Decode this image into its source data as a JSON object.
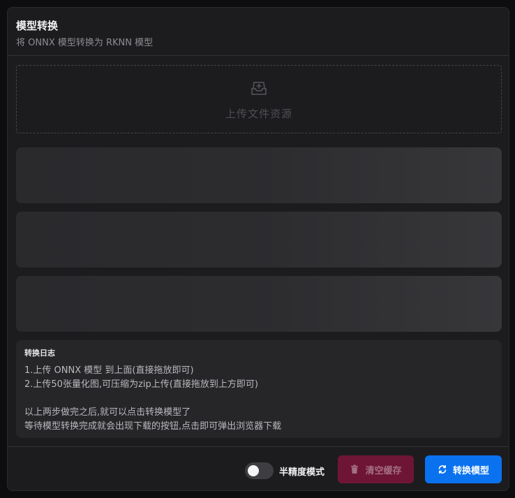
{
  "header": {
    "title": "模型转换",
    "subtitle": "将 ONNX 模型转换为 RKNN 模型"
  },
  "upload": {
    "label": "上传文件资源",
    "icon": "inbox-upload-icon"
  },
  "log": {
    "title": "转换日志",
    "lines": [
      "1.上传 ONNX 模型 到上面(直接拖放即可)",
      "2.上传50张量化图,可压缩为zip上传(直接拖放到上方即可)",
      "",
      "以上两步做完之后,就可以点击转换模型了",
      "等待模型转换完成就会出现下载的按钮,点击即可弹出浏览器下载"
    ]
  },
  "footer": {
    "toggle_label": "半精度模式",
    "toggle_on": false,
    "clear_label": "清空缓存",
    "clear_icon": "trash-icon",
    "convert_label": "转换模型",
    "convert_icon": "refresh-icon"
  },
  "colors": {
    "background": "#1c1c1f",
    "danger": "#6e1535",
    "primary": "#0a72ef"
  }
}
